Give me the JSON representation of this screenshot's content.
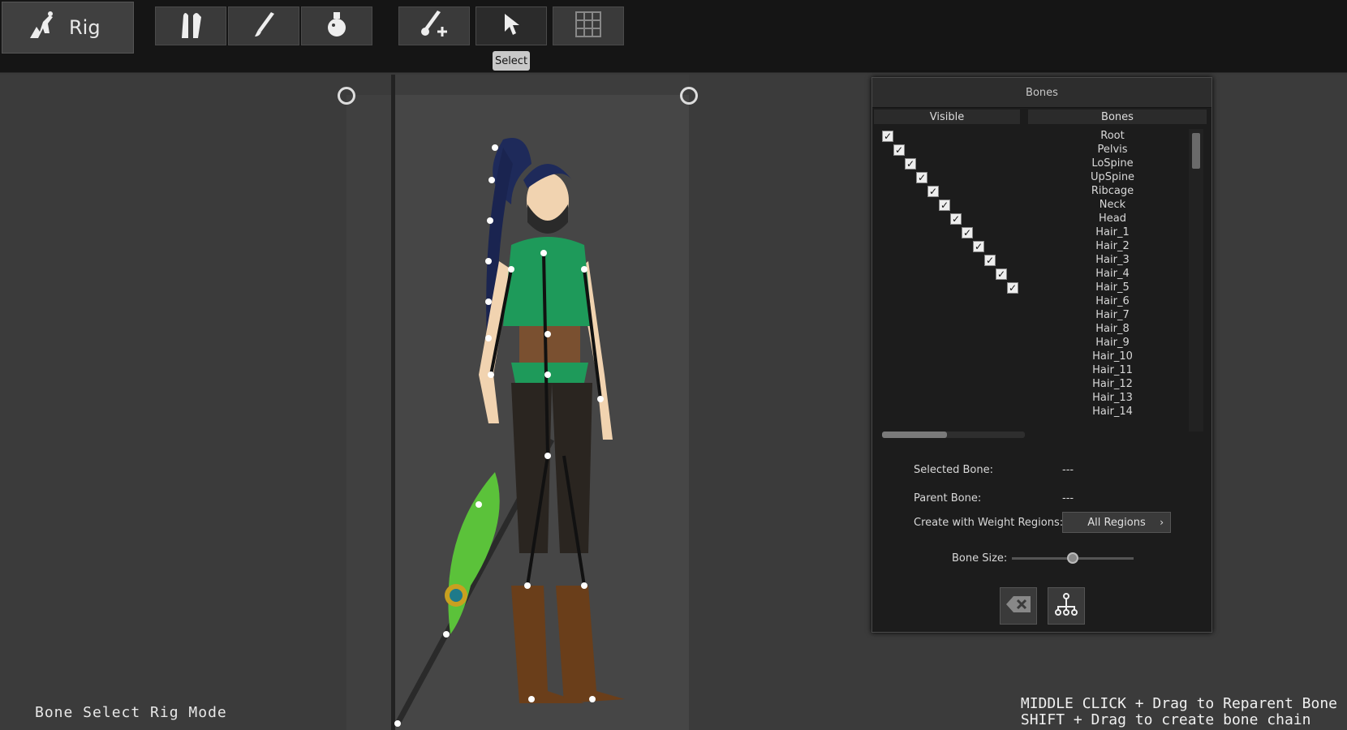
{
  "toolbar": {
    "rig_label": "Rig",
    "tooltip": "Select",
    "tools": [
      {
        "name": "bones-mode-icon"
      },
      {
        "name": "paint-brush-icon"
      },
      {
        "name": "potion-icon"
      },
      {
        "name": "add-bone-icon"
      },
      {
        "name": "select-cursor-icon"
      },
      {
        "name": "grid-icon"
      }
    ]
  },
  "viewport": {
    "mode_label": "Bone Select Rig Mode",
    "hint_1": "MIDDLE CLICK + Drag to Reparent Bone",
    "hint_2": "SHIFT + Drag to create bone chain"
  },
  "bones_panel": {
    "title": "Bones",
    "col_visible": "Visible",
    "col_bones": "Bones",
    "bones": [
      "Root",
      "Pelvis",
      "LoSpine",
      "UpSpine",
      "Ribcage",
      "Neck",
      "Head",
      "Hair_1",
      "Hair_2",
      "Hair_3",
      "Hair_4",
      "Hair_5",
      "Hair_6",
      "Hair_7",
      "Hair_8",
      "Hair_9",
      "Hair_10",
      "Hair_11",
      "Hair_12",
      "Hair_13",
      "Hair_14"
    ],
    "visible_checked_count": 12,
    "selected_bone_label": "Selected Bone:",
    "selected_bone_value": "---",
    "parent_bone_label": "Parent Bone:",
    "parent_bone_value": "---",
    "weight_regions_label": "Create with Weight Regions:",
    "weight_regions_value": "All Regions",
    "bone_size_label": "Bone Size:",
    "bone_size_level": 0.5
  }
}
